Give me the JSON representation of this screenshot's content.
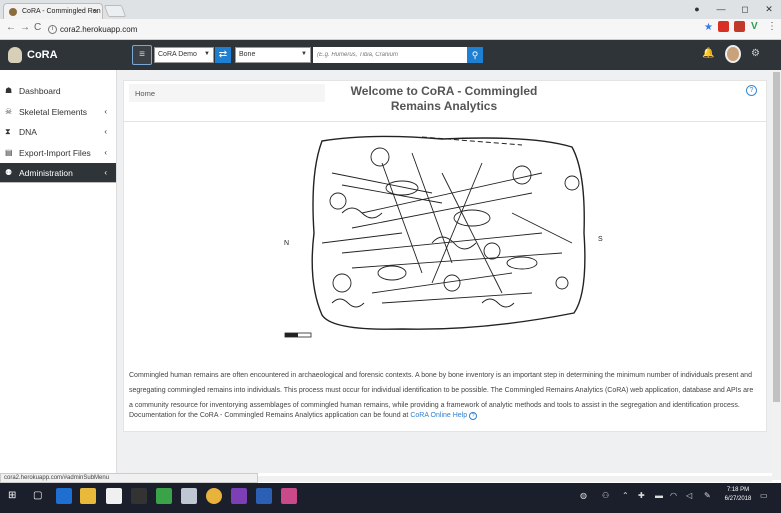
{
  "browser": {
    "tab_title": "CoRA - Commingled Ren",
    "tab_close": "×",
    "url": "cora2.herokuapp.com",
    "window_controls": [
      "—",
      "◻",
      "✕"
    ],
    "status_url": "cora2.herokuapp.com/#adminSubMenu"
  },
  "app": {
    "brand": "CoRA",
    "project_select": "CoRA Demo",
    "type_select": "Bone",
    "search_placeholder": "(E.g. Humerus, Tibia, Cranium",
    "accent": "#1f7fd1",
    "nav_bg": "#2f3438"
  },
  "sidebar": {
    "items": [
      {
        "label": "Dashboard",
        "icon": "dashboard-icon",
        "glyph": "☗",
        "chevron": ""
      },
      {
        "label": "Skeletal Elements",
        "icon": "skull-icon",
        "glyph": "☠",
        "chevron": "‹"
      },
      {
        "label": "DNA",
        "icon": "dna-icon",
        "glyph": "⧗",
        "chevron": "‹"
      },
      {
        "label": "Export-Import Files",
        "icon": "files-icon",
        "glyph": "▤",
        "chevron": "‹"
      },
      {
        "label": "Administration",
        "icon": "users-icon",
        "glyph": "⚉",
        "chevron": "‹"
      }
    ]
  },
  "main": {
    "breadcrumb": "Home",
    "title_line1": "Welcome to CoRA - Commingled",
    "title_line2": "Remains Analytics",
    "intro": "Commingled human remains are often encountered in archaeological and forensic contexts. A bone by bone inventory is an important step in determining the minimum number of individuals present and segregating commingled remains into individuals. This process must occur for individual identification to be possible. The Commingled Remains Analytics (CoRA) web application, database and APIs are a community resource for inventorying assemblages of commingled human remains, while providing a framework of analytic methods and tools to assist in the segregation and identification process.",
    "doc_text": "Documentation for the CoRA - Commingled Remains Analytics application can be found at ",
    "doc_link": "CoRA Online Help",
    "map_label_left": "N",
    "map_label_right": "S"
  },
  "taskbar": {
    "time": "7:18 PM",
    "date": "6/27/2018"
  }
}
